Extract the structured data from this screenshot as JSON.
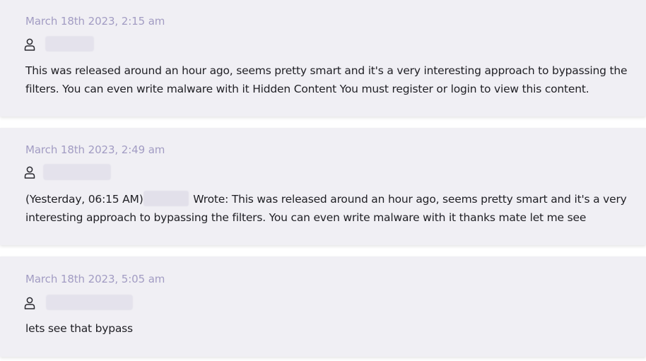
{
  "posts": [
    {
      "timestamp": "March 18th 2023, 2:15 am",
      "body": "This was released around an hour ago, seems pretty smart and it's a very interesting approach to bypassing the filters. You can even write malware with it Hidden Content You must register or login to view this content."
    },
    {
      "timestamp": "March 18th 2023, 2:49 am",
      "body_prefix": "(Yesterday, 06:15 AM)",
      "body_suffix": " Wrote: This was released around an hour ago, seems pretty smart and it's a very interesting approach to bypassing the filters. You can even write malware with it thanks mate let me see"
    },
    {
      "timestamp": "March 18th 2023, 5:05 am",
      "body": "lets see that bypass"
    }
  ],
  "icons": {
    "author": "user-icon"
  },
  "colors": {
    "card_background": "#f0eff4",
    "timestamp": "#a29cc3",
    "text": "#1f1f24"
  }
}
